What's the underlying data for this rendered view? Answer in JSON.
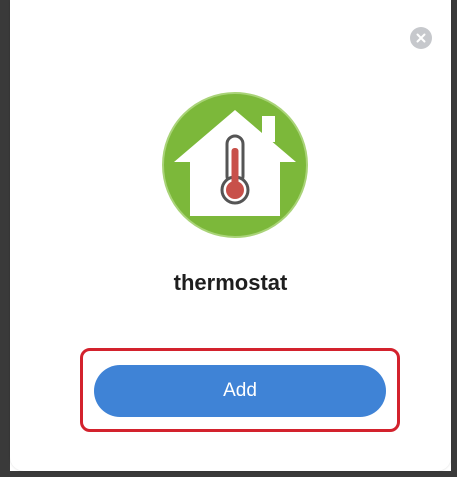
{
  "dialog": {
    "device_name": "thermostat",
    "add_button_label": "Add",
    "close_icon": "close-icon",
    "device_icon": "house-thermometer-icon"
  },
  "colors": {
    "icon_green": "#7cb83a",
    "button_blue": "#3f83d6",
    "highlight_red": "#d3222d",
    "close_gray": "#c6c8cc",
    "thermometer_red": "#c8504a"
  }
}
